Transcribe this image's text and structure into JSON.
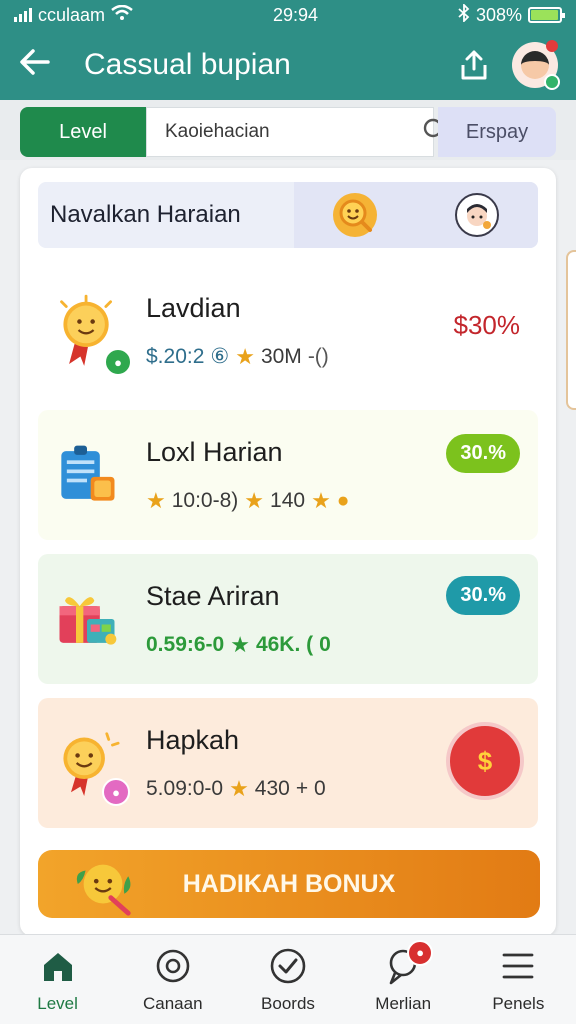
{
  "status_bar": {
    "carrier": "cculaam",
    "time": "29:94",
    "battery_text": "308%",
    "battery_level": 0.95
  },
  "app_bar": {
    "title": "Cassual bupian"
  },
  "tabs": {
    "level_label": "Level",
    "search_value": "Kaoiehacian",
    "display_label": "Erspay"
  },
  "section": {
    "title": "Navalkan Haraian",
    "icons": [
      "smile-magnifier-icon",
      "avatar-icon"
    ]
  },
  "tasks": [
    {
      "title": "Lavdian",
      "meta_left": "$.20:2",
      "meta_symbol": "⑥",
      "meta_mid": "30M",
      "meta_right": "-()",
      "reward": "$30%",
      "reward_style": "text",
      "icon": "sun-medal-icon",
      "bg": "#ffffff",
      "meta_color": "#2f6e8c"
    },
    {
      "title": "Loxl Harian",
      "meta_left": "10:0-8)",
      "meta_symbol": "",
      "meta_mid": "140",
      "meta_right": "★",
      "reward": "30.%",
      "reward_style": "pill",
      "reward_color": "#7cc21d",
      "icon": "clipboard-icon",
      "bg": "#fbfdf1",
      "meta_color": "#3a3a3a"
    },
    {
      "title": "Stae Ariran",
      "meta_left": "0.59:6-0",
      "meta_symbol": "",
      "meta_mid": "46K. (",
      "meta_right": "0",
      "reward": "30.%",
      "reward_style": "pill",
      "reward_color": "#1f9aa8",
      "icon": "gift-box-icon",
      "bg": "#eef7ec",
      "meta_color": "#2c9a3a"
    },
    {
      "title": "Hapkah",
      "meta_left": "5.09:0-0",
      "meta_symbol": "",
      "meta_mid": "430",
      "meta_right": "+ 0",
      "reward": "$",
      "reward_style": "seal",
      "icon": "smile-medal-icon",
      "bg": "#fdebdc",
      "meta_color": "#3a3a3a"
    }
  ],
  "bonus": {
    "label": "HADIKAH BONUX"
  },
  "bottom_nav": [
    {
      "label": "Level",
      "icon": "home-icon",
      "active": true
    },
    {
      "label": "Canaan",
      "icon": "target-icon",
      "active": false
    },
    {
      "label": "Boords",
      "icon": "check-circle-icon",
      "active": false
    },
    {
      "label": "Merlian",
      "icon": "chat-icon",
      "active": false,
      "badge": "●"
    },
    {
      "label": "Penels",
      "icon": "menu-icon",
      "active": false
    }
  ]
}
